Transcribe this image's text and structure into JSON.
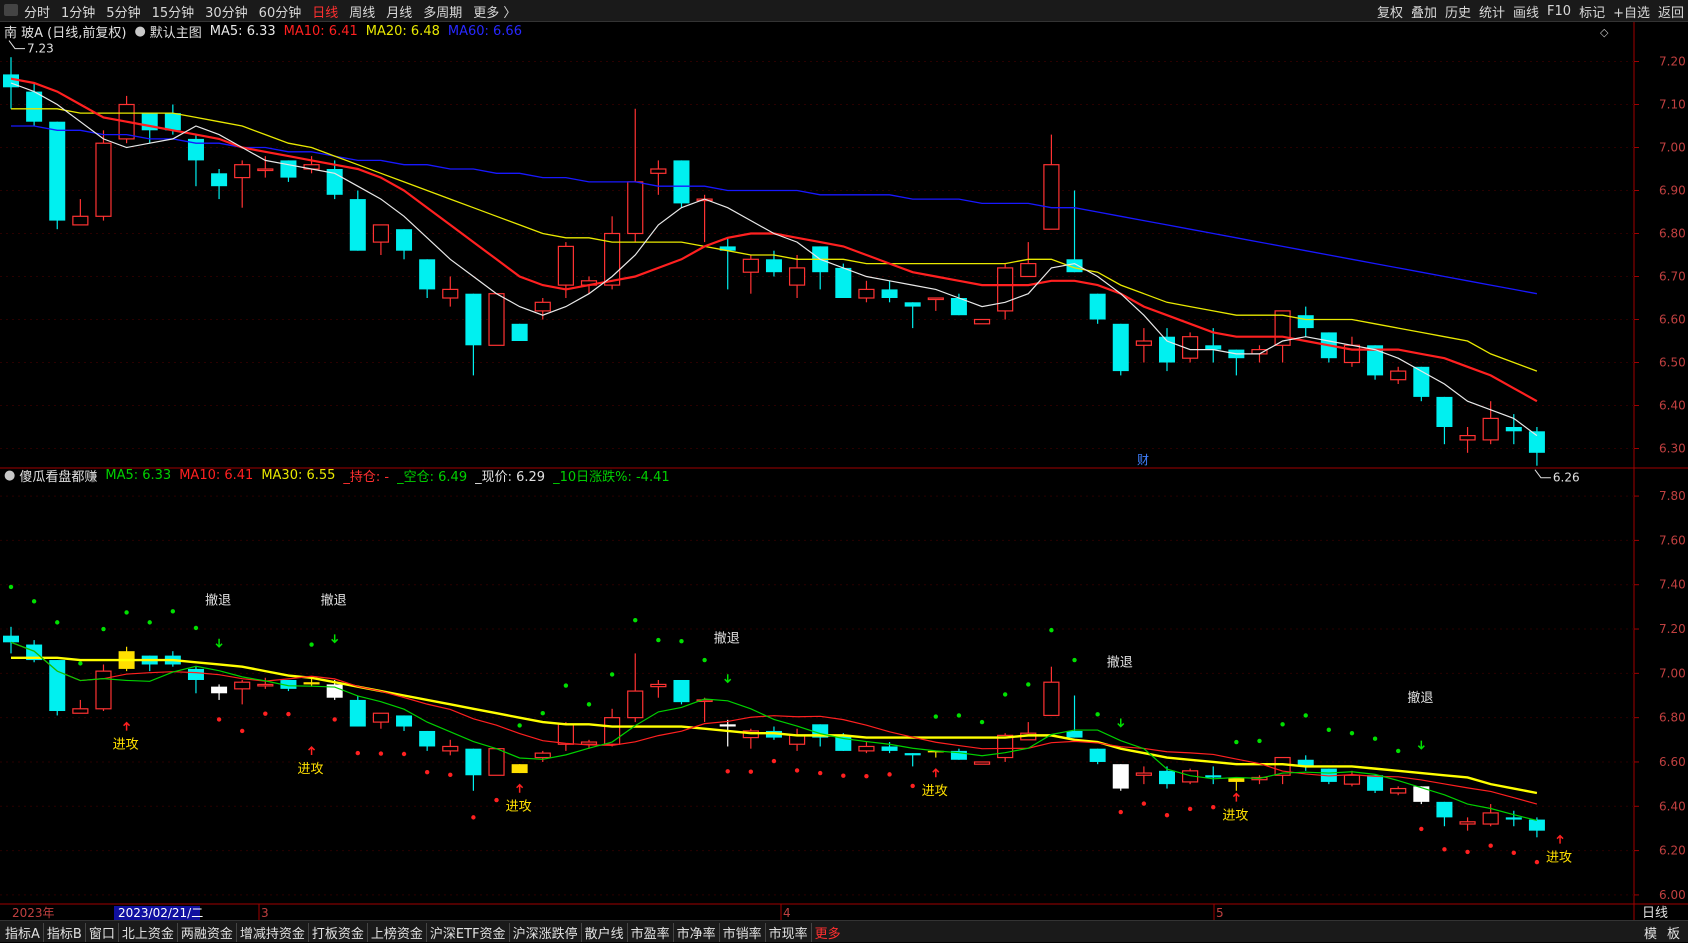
{
  "toolbar": {
    "left_tabs": [
      "分时",
      "1分钟",
      "5分钟",
      "15分钟",
      "30分钟",
      "60分钟",
      "日线",
      "周线",
      "月线",
      "多周期",
      "更多 〉"
    ],
    "active_tab": "日线",
    "right_tools": [
      "复权",
      "叠加",
      "历史",
      "统计",
      "画线",
      "F10",
      "标记",
      "+自选",
      "返回"
    ]
  },
  "main_legend": {
    "title": "南 玻A (日线,前复权)",
    "chart_name": "默认主图",
    "ma5": "MA5: 6.33",
    "ma10": "MA10: 6.41",
    "ma20": "MA20: 6.48",
    "ma60": "MA60: 6.66"
  },
  "sub_legend": {
    "name": "傻瓜看盘都赚",
    "ma5": "MA5: 6.33",
    "ma10": "MA10: 6.41",
    "ma30": "MA30: 6.55",
    "hold": "_持仓: -",
    "empty": "_空仓: 6.49",
    "price": "_现价: 6.29",
    "chg10": "_10日涨跌%: -4.41"
  },
  "colors": {
    "up": "#ff3232",
    "down": "#00f0f0",
    "ma5": "#e8e8e8",
    "ma10": "#ff2020",
    "ma20": "#e8e800",
    "ma60": "#1818ff",
    "sub_ma5": "#00d000",
    "grid": "#8b0000",
    "axis_text": "#c04040"
  },
  "bottom_bar": {
    "tabs": [
      "指标A",
      "指标B",
      "窗口",
      "北上资金",
      "两融资金",
      "增减持资金",
      "打板资金",
      "上榜资金",
      "沪深ETF资金",
      "沪深涨跌停",
      "散户线",
      "市盈率",
      "市净率",
      "市销率",
      "市现率"
    ],
    "more": "更多",
    "right": [
      "模",
      "板"
    ]
  },
  "chart_data": [
    {
      "type": "candlestick",
      "title": "南 玻A (日线,前复权)",
      "ylim": [
        6.25,
        7.25
      ],
      "yticks": [
        "7.20",
        "7.10",
        "7.00",
        "6.90",
        "6.80",
        "6.70",
        "6.60",
        "6.50",
        "6.40",
        "6.30"
      ],
      "annotations": {
        "high_label": "7.23",
        "low_label": "6.26",
        "event_mark": "财",
        "period_label": "日线"
      },
      "x_labels": [
        "2023年",
        "2023/02/21/二",
        "3",
        "4",
        "5"
      ],
      "candles": [
        [
          7.17,
          7.14,
          7.21,
          7.09
        ],
        [
          7.13,
          7.06,
          7.15,
          7.05
        ],
        [
          7.06,
          6.83,
          7.06,
          6.81
        ],
        [
          6.82,
          6.84,
          6.88,
          6.82
        ],
        [
          6.84,
          7.01,
          7.04,
          6.83
        ],
        [
          7.02,
          7.1,
          7.12,
          7.01
        ],
        [
          7.08,
          7.04,
          7.08,
          7.01
        ],
        [
          7.08,
          7.04,
          7.1,
          7.03
        ],
        [
          7.02,
          6.97,
          7.03,
          6.91
        ],
        [
          6.94,
          6.91,
          6.95,
          6.88
        ],
        [
          6.93,
          6.96,
          6.97,
          6.86
        ],
        [
          6.95,
          6.95,
          6.98,
          6.93
        ],
        [
          6.97,
          6.93,
          6.97,
          6.92
        ],
        [
          6.95,
          6.96,
          6.98,
          6.94
        ],
        [
          6.95,
          6.89,
          6.97,
          6.88
        ],
        [
          6.88,
          6.76,
          6.9,
          6.76
        ],
        [
          6.78,
          6.82,
          6.82,
          6.75
        ],
        [
          6.81,
          6.76,
          6.81,
          6.74
        ],
        [
          6.74,
          6.67,
          6.74,
          6.65
        ],
        [
          6.65,
          6.67,
          6.7,
          6.63
        ],
        [
          6.66,
          6.54,
          6.66,
          6.47
        ],
        [
          6.54,
          6.66,
          6.66,
          6.54
        ],
        [
          6.59,
          6.55,
          6.59,
          6.55
        ],
        [
          6.62,
          6.64,
          6.65,
          6.6
        ],
        [
          6.68,
          6.77,
          6.78,
          6.65
        ],
        [
          6.68,
          6.69,
          6.7,
          6.66
        ],
        [
          6.68,
          6.8,
          6.84,
          6.67
        ],
        [
          6.8,
          6.92,
          7.09,
          6.78
        ],
        [
          6.94,
          6.95,
          6.97,
          6.89
        ],
        [
          6.97,
          6.87,
          6.97,
          6.86
        ],
        [
          6.88,
          6.88,
          6.89,
          6.78
        ],
        [
          6.77,
          6.76,
          6.79,
          6.67
        ],
        [
          6.71,
          6.74,
          6.75,
          6.66
        ],
        [
          6.74,
          6.71,
          6.76,
          6.7
        ],
        [
          6.68,
          6.72,
          6.75,
          6.65
        ],
        [
          6.77,
          6.71,
          6.77,
          6.67
        ],
        [
          6.72,
          6.65,
          6.73,
          6.65
        ],
        [
          6.65,
          6.67,
          6.69,
          6.64
        ],
        [
          6.67,
          6.65,
          6.69,
          6.64
        ],
        [
          6.64,
          6.63,
          6.64,
          6.58
        ],
        [
          6.65,
          6.65,
          6.65,
          6.62
        ],
        [
          6.65,
          6.61,
          6.66,
          6.61
        ],
        [
          6.59,
          6.6,
          6.6,
          6.59
        ],
        [
          6.62,
          6.72,
          6.73,
          6.6
        ],
        [
          6.7,
          6.73,
          6.78,
          6.7
        ],
        [
          6.81,
          6.96,
          7.03,
          6.81
        ],
        [
          6.74,
          6.71,
          6.9,
          6.71
        ],
        [
          6.66,
          6.6,
          6.66,
          6.59
        ],
        [
          6.59,
          6.48,
          6.59,
          6.47
        ],
        [
          6.54,
          6.55,
          6.58,
          6.5
        ],
        [
          6.56,
          6.5,
          6.58,
          6.48
        ],
        [
          6.51,
          6.56,
          6.57,
          6.5
        ],
        [
          6.54,
          6.53,
          6.58,
          6.5
        ],
        [
          6.53,
          6.51,
          6.53,
          6.47
        ],
        [
          6.52,
          6.53,
          6.54,
          6.5
        ],
        [
          6.54,
          6.62,
          6.62,
          6.5
        ],
        [
          6.61,
          6.58,
          6.63,
          6.56
        ],
        [
          6.57,
          6.51,
          6.57,
          6.5
        ],
        [
          6.5,
          6.54,
          6.56,
          6.49
        ],
        [
          6.54,
          6.47,
          6.54,
          6.46
        ],
        [
          6.46,
          6.48,
          6.49,
          6.45
        ],
        [
          6.49,
          6.42,
          6.49,
          6.41
        ],
        [
          6.42,
          6.35,
          6.42,
          6.31
        ],
        [
          6.32,
          6.33,
          6.35,
          6.29
        ],
        [
          6.32,
          6.37,
          6.41,
          6.31
        ],
        [
          6.35,
          6.34,
          6.38,
          6.31
        ],
        [
          6.34,
          6.29,
          6.35,
          6.26
        ]
      ],
      "ma5": [
        7.15,
        7.13,
        7.1,
        7.06,
        7.02,
        7.0,
        7.01,
        7.02,
        7.05,
        7.03,
        7.0,
        6.97,
        6.96,
        6.95,
        6.94,
        6.91,
        6.88,
        6.84,
        6.79,
        6.74,
        6.7,
        6.66,
        6.63,
        6.61,
        6.63,
        6.66,
        6.7,
        6.75,
        6.82,
        6.86,
        6.88,
        6.86,
        6.83,
        6.8,
        6.78,
        6.74,
        6.72,
        6.7,
        6.69,
        6.68,
        6.67,
        6.65,
        6.63,
        6.64,
        6.66,
        6.72,
        6.73,
        6.7,
        6.66,
        6.61,
        6.55,
        6.53,
        6.53,
        6.52,
        6.52,
        6.55,
        6.56,
        6.55,
        6.54,
        6.53,
        6.51,
        6.48,
        6.45,
        6.41,
        6.39,
        6.37,
        6.33
      ],
      "ma10": [
        7.16,
        7.15,
        7.13,
        7.1,
        7.07,
        7.06,
        7.05,
        7.04,
        7.03,
        7.02,
        7.0,
        6.99,
        6.98,
        6.97,
        6.96,
        6.95,
        6.93,
        6.9,
        6.86,
        6.82,
        6.78,
        6.74,
        6.7,
        6.68,
        6.67,
        6.68,
        6.69,
        6.7,
        6.72,
        6.74,
        6.77,
        6.79,
        6.8,
        6.8,
        6.79,
        6.78,
        6.77,
        6.75,
        6.73,
        6.71,
        6.7,
        6.69,
        6.68,
        6.68,
        6.68,
        6.69,
        6.69,
        6.68,
        6.66,
        6.63,
        6.61,
        6.59,
        6.57,
        6.56,
        6.56,
        6.56,
        6.55,
        6.54,
        6.53,
        6.53,
        6.53,
        6.52,
        6.51,
        6.49,
        6.47,
        6.44,
        6.41
      ],
      "ma20": [
        7.09,
        7.09,
        7.09,
        7.08,
        7.08,
        7.08,
        7.08,
        7.08,
        7.07,
        7.06,
        7.05,
        7.03,
        7.01,
        7.0,
        6.98,
        6.96,
        6.94,
        6.92,
        6.9,
        6.88,
        6.86,
        6.84,
        6.82,
        6.8,
        6.79,
        6.79,
        6.78,
        6.78,
        6.78,
        6.78,
        6.77,
        6.76,
        6.75,
        6.75,
        6.74,
        6.74,
        6.74,
        6.73,
        6.73,
        6.73,
        6.73,
        6.73,
        6.73,
        6.73,
        6.74,
        6.74,
        6.72,
        6.71,
        6.68,
        6.66,
        6.64,
        6.63,
        6.62,
        6.61,
        6.61,
        6.61,
        6.6,
        6.6,
        6.6,
        6.59,
        6.58,
        6.57,
        6.56,
        6.55,
        6.52,
        6.5,
        6.48
      ],
      "ma60": [
        7.05,
        7.05,
        7.04,
        7.04,
        7.03,
        7.03,
        7.02,
        7.02,
        7.01,
        7.01,
        7.0,
        7.0,
        6.99,
        6.99,
        6.98,
        6.97,
        6.97,
        6.96,
        6.96,
        6.95,
        6.95,
        6.94,
        6.94,
        6.93,
        6.93,
        6.92,
        6.92,
        6.92,
        6.91,
        6.91,
        6.91,
        6.9,
        6.9,
        6.9,
        6.9,
        6.89,
        6.89,
        6.89,
        6.89,
        6.88,
        6.88,
        6.88,
        6.87,
        6.87,
        6.87,
        6.86,
        6.86,
        6.85,
        6.84,
        6.83,
        6.82,
        6.81,
        6.8,
        6.79,
        6.78,
        6.77,
        6.76,
        6.75,
        6.74,
        6.73,
        6.72,
        6.71,
        6.7,
        6.69,
        6.68,
        6.67,
        6.66
      ]
    },
    {
      "type": "candlestick-indicator",
      "title": "傻瓜看盘都赚",
      "ylim": [
        5.95,
        7.85
      ],
      "yticks": [
        "7.80",
        "7.60",
        "7.40",
        "7.20",
        "7.00",
        "6.80",
        "6.60",
        "6.40",
        "6.20",
        "6.00"
      ],
      "signals": [
        {
          "text": "撤退",
          "i": 9,
          "price": 7.31
        },
        {
          "text": "撤退",
          "i": 14,
          "price": 7.31
        },
        {
          "text": "撤退",
          "i": 31,
          "price": 7.14
        },
        {
          "text": "撤退",
          "i": 48,
          "price": 7.03
        },
        {
          "text": "撤退",
          "i": 61,
          "price": 6.87
        },
        {
          "text": "进攻",
          "i": 5,
          "price": 6.66
        },
        {
          "text": "进攻",
          "i": 13,
          "price": 6.55
        },
        {
          "text": "进攻",
          "i": 22,
          "price": 6.38
        },
        {
          "text": "进攻",
          "i": 40,
          "price": 6.45
        },
        {
          "text": "进攻",
          "i": 53,
          "price": 6.34
        },
        {
          "text": "进攻",
          "i": 67,
          "price": 6.15
        }
      ]
    }
  ]
}
